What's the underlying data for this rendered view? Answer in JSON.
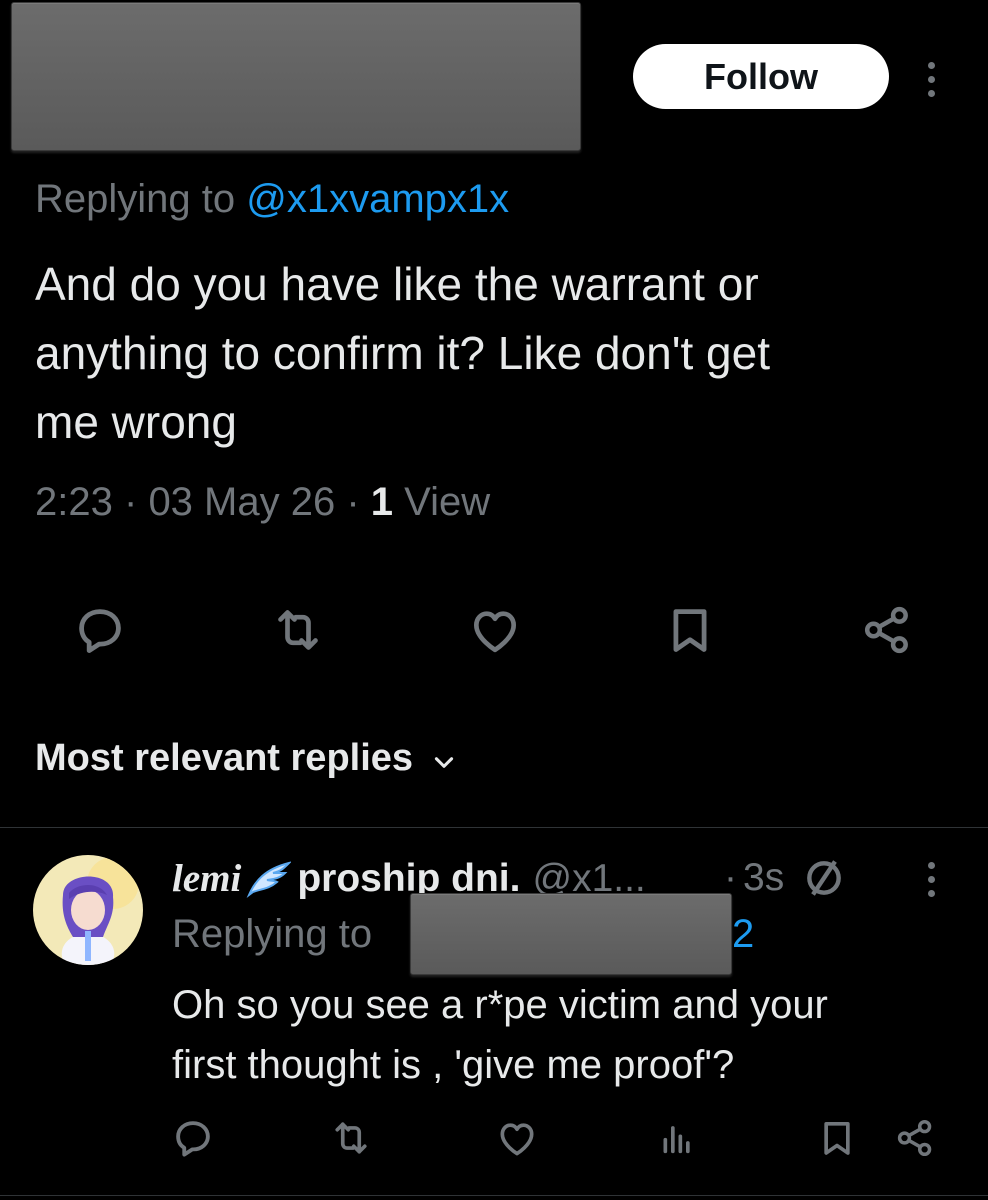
{
  "header": {
    "follow_label": "Follow"
  },
  "tweet": {
    "replying_prefix": "Replying to",
    "replying_handle": "@x1xvampx1x",
    "text_line1": "And do you have like the warrant or",
    "text_line2": "anything to confirm it? Like don't get",
    "text_line3": "me wrong",
    "time": "2:23",
    "date": "03 May 26",
    "views_count": "1",
    "views_label": "View",
    "separator": "·"
  },
  "replies_section": {
    "title": "Most relevant replies"
  },
  "reply": {
    "name": "lemi",
    "name_suffix": "proship dni.",
    "handle": "@x1...",
    "time": "3s",
    "separator": "·",
    "replying_prefix": "Replying to",
    "replying_handle_tail": "2",
    "text_line1": "Oh so you see a r*pe victim and your",
    "text_line2": "first thought is , 'give me proof'?"
  },
  "icons": {
    "reply": "reply-icon",
    "retweet": "retweet-icon",
    "like": "like-icon",
    "bookmark": "bookmark-icon",
    "share": "share-icon",
    "views": "views-icon",
    "more": "more-icon",
    "wing": "wing-icon",
    "verified_slash": "slashed-circle-icon"
  },
  "colors": {
    "background": "#000000",
    "text": "#e7e9ea",
    "muted": "#71767b",
    "link": "#1d9bf0",
    "divider": "#2f3336"
  }
}
